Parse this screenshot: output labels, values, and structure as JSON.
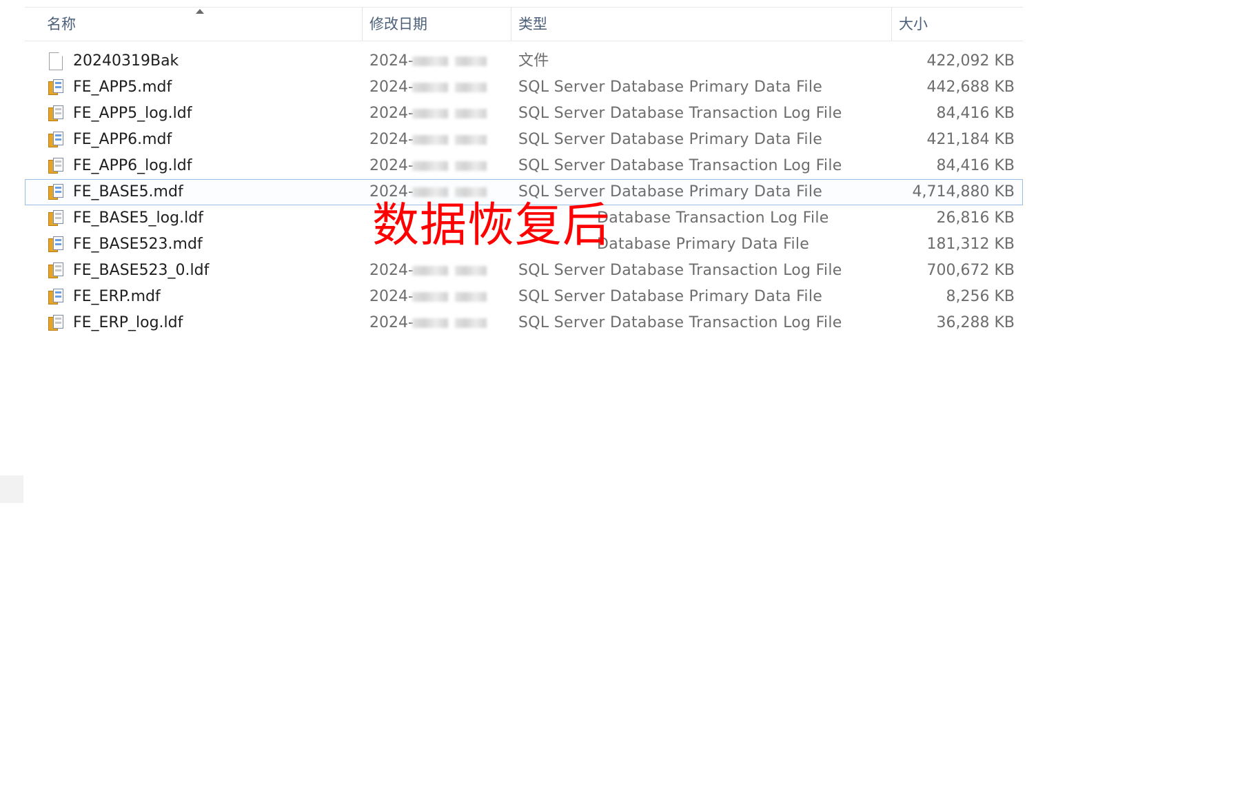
{
  "columns": {
    "name": "名称",
    "date": "修改日期",
    "type": "类型",
    "size": "大小"
  },
  "files": [
    {
      "name": "20240319Bak",
      "date": "2024-",
      "type": "文件",
      "size": "422,092 KB",
      "icon": "file-icon"
    },
    {
      "name": "FE_APP5.mdf",
      "date": "2024-",
      "type": "SQL Server Database Primary Data File",
      "size": "442,688 KB",
      "icon": "database-primary-icon"
    },
    {
      "name": "FE_APP5_log.ldf",
      "date": "2024-",
      "type": "SQL Server Database Transaction Log File",
      "size": "84,416 KB",
      "icon": "database-log-icon"
    },
    {
      "name": "FE_APP6.mdf",
      "date": "2024-",
      "type": "SQL Server Database Primary Data File",
      "size": "421,184 KB",
      "icon": "database-primary-icon"
    },
    {
      "name": "FE_APP6_log.ldf",
      "date": "2024-",
      "type": "SQL Server Database Transaction Log File",
      "size": "84,416 KB",
      "icon": "database-log-icon"
    },
    {
      "name": "FE_BASE5.mdf",
      "date": "2024-",
      "type": "SQL Server Database Primary Data File",
      "size": "4,714,880 KB",
      "icon": "database-primary-icon",
      "selected": true
    },
    {
      "name": "FE_BASE5_log.ldf",
      "date": "",
      "type": "Database Transaction Log File",
      "size": "26,816 KB",
      "icon": "database-log-icon"
    },
    {
      "name": "FE_BASE523.mdf",
      "date": "",
      "type": "Database Primary Data File",
      "size": "181,312 KB",
      "icon": "database-primary-icon"
    },
    {
      "name": "FE_BASE523_0.ldf",
      "date": "2024-",
      "type": "SQL Server Database Transaction Log File",
      "size": "700,672 KB",
      "icon": "database-log-icon"
    },
    {
      "name": "FE_ERP.mdf",
      "date": "2024-",
      "type": "SQL Server Database Primary Data File",
      "size": "8,256 KB",
      "icon": "database-primary-icon"
    },
    {
      "name": "FE_ERP_log.ldf",
      "date": "2024-",
      "type": "SQL Server Database Transaction Log File",
      "size": "36,288 KB",
      "icon": "database-log-icon"
    }
  ],
  "overlay_caption": "数据恢复后",
  "colors": {
    "header_text": "#4c607a",
    "caption": "#ff0000",
    "selection_border": "#99c0e4"
  }
}
